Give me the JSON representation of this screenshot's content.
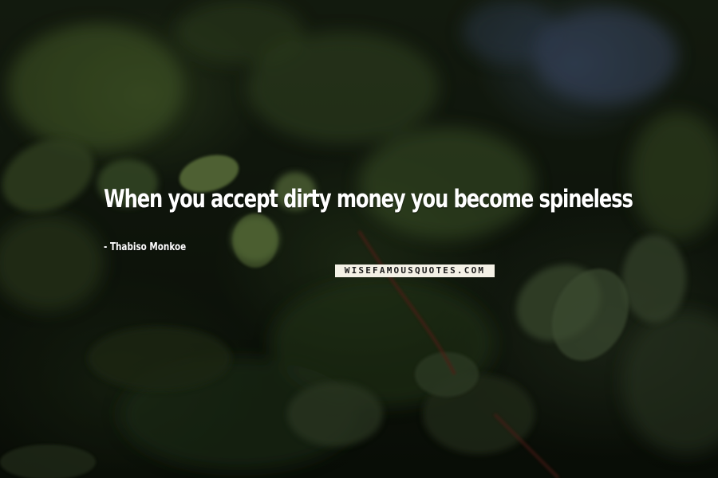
{
  "quote": {
    "text": "When you accept dirty money you become spineless",
    "author_prefix": "- ",
    "author": "Thabiso Monkoe"
  },
  "watermark": {
    "text": "WISEFAMOUSQUOTES.COM"
  },
  "colors": {
    "text": "#ffffff",
    "watermark_bg": "#f4f1e6",
    "foliage_dark": "#141d10",
    "foliage_light": "#8aa85a"
  }
}
